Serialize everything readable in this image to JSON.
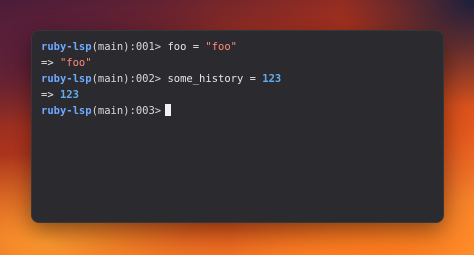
{
  "terminal": {
    "lines": [
      {
        "prompt_name": "ruby-lsp",
        "prompt_rest": "(main):001>",
        "code_pre": " foo = ",
        "code_str": "\"foo\"",
        "code_num": ""
      },
      {
        "arrow": "=> ",
        "result_str": "\"foo\"",
        "result_num": ""
      },
      {
        "prompt_name": "ruby-lsp",
        "prompt_rest": "(main):002>",
        "code_pre": " some_history = ",
        "code_str": "",
        "code_num": "123"
      },
      {
        "arrow": "=> ",
        "result_str": "",
        "result_num": "123"
      },
      {
        "prompt_name": "ruby-lsp",
        "prompt_rest": "(main):003>"
      }
    ]
  },
  "colors": {
    "background": "#2b2b2f",
    "prompt_name": "#6ea8ff",
    "string": "#ff8a80",
    "number": "#61aeee"
  }
}
